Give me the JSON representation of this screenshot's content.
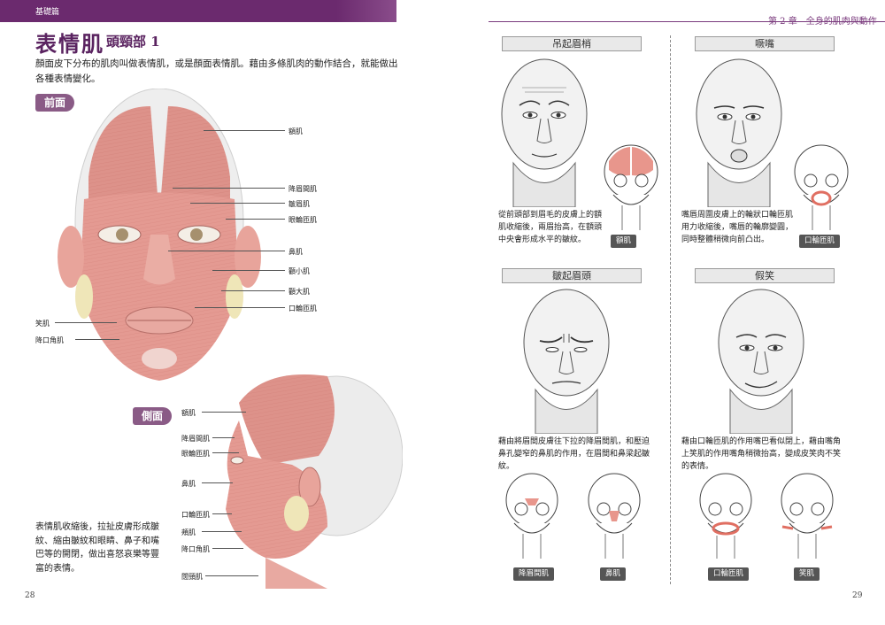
{
  "left_page": {
    "section_tag": "基礎篇",
    "title": "表情肌",
    "subtitle": "頭頸部 1",
    "intro": "顏面皮下分布的肌肉叫做表情肌，或是顏面表情肌。藉由多條肌肉的動作結合，就能做出各種表情變化。",
    "front_label": "前面",
    "side_label": "側面",
    "front_muscles": [
      "額肌",
      "降眉間肌",
      "皺眉肌",
      "眼輪匝肌",
      "鼻肌",
      "顴小肌",
      "顴大肌",
      "口輪匝肌",
      "笑肌",
      "降口角肌"
    ],
    "side_muscles": [
      "額肌",
      "降眉間肌",
      "眼輪匝肌",
      "鼻肌",
      "口輪匝肌",
      "頰肌",
      "降口角肌",
      "闊頸肌"
    ],
    "paragraph": "表情肌收縮後，拉扯皮膚形成皺紋、縮由皺紋和眼睛、鼻子和嘴巴等的開閉，做出喜怒哀樂等豐富的表情。",
    "page_number": "28"
  },
  "right_page": {
    "chapter": "第 2 章　全身的肌肉與動作",
    "page_number": "29",
    "panels": [
      {
        "title": "吊起眉梢",
        "desc": "從前頭部到眉毛的皮膚上的額肌收縮後，兩眉抬高，在額頭中央會形成水平的皺紋。",
        "tags": [
          "額肌"
        ]
      },
      {
        "title": "噘嘴",
        "desc": "嘴唇周圍皮膚上的輪狀口輪匝肌用力收縮後，嘴唇的輪廓變圓，同時整體稍微向前凸出。",
        "tags": [
          "口輪匝肌"
        ]
      },
      {
        "title": "皺起眉頭",
        "desc": "藉由將眉間皮膚往下拉的降眉間肌，和壓迫鼻孔變窄的鼻肌的作用，在眉間和鼻梁起皺紋。",
        "tags": [
          "降眉間肌",
          "鼻肌"
        ]
      },
      {
        "title": "假笑",
        "desc": "藉由口輪匝肌的作用嘴巴看似閉上，藉由嘴角上笑肌的作用嘴角稍微抬高，變成皮笑肉不笑的表情。",
        "tags": [
          "口輪匝肌",
          "笑肌"
        ]
      }
    ]
  },
  "colors": {
    "brand_purple": "#6b2a6e",
    "muscle_red": "#d98a82",
    "tag_gray": "#555555"
  }
}
